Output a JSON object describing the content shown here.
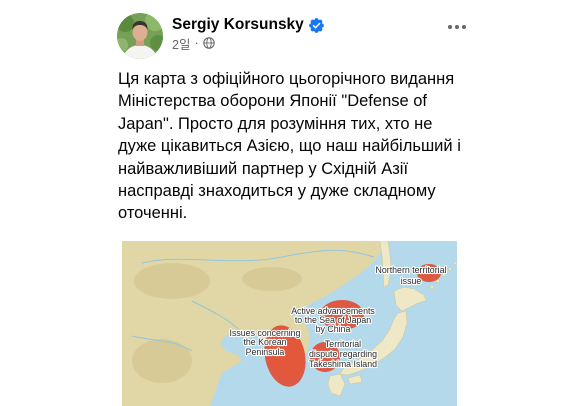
{
  "colors": {
    "verified_badge": "#1877F2",
    "text_primary": "#050505",
    "text_secondary": "#65676B",
    "map_sea": "#B4D9EA",
    "map_land": "#E1D6A5",
    "map_japan": "#EFE8C6",
    "map_highlight": "#E2472B"
  },
  "post": {
    "author": {
      "name": "Sergiy Korsunsky",
      "verified": true,
      "badge_icon": "verified-badge-icon"
    },
    "meta": {
      "time": "2일",
      "separator": "·",
      "audience_icon": "globe-icon"
    },
    "more_icon": "more-options-icon",
    "text_lines": [
      "Ця карта з офіційного цьогорічного видання",
      "Міністерства оборони Японії \"Defense of",
      "Japan\". Просто для розуміння тих, хто не",
      "дуже цікавиться Азією, що наш найбільший і",
      "найважливіший партнер у Східній Азії",
      "насправді знаходиться у дуже складному",
      "оточенні."
    ]
  },
  "map": {
    "labels": {
      "northern_territorial": [
        "Northern territorial",
        "issue"
      ],
      "sea_of_japan": [
        "Active advancements",
        "to the Sea of Japan",
        "by China"
      ],
      "korean_peninsula": [
        "Issues concerning",
        "the Korean",
        "Peninsula"
      ],
      "takeshima": [
        "Territorial",
        "dispute regarding",
        "Takeshima Island"
      ]
    }
  }
}
